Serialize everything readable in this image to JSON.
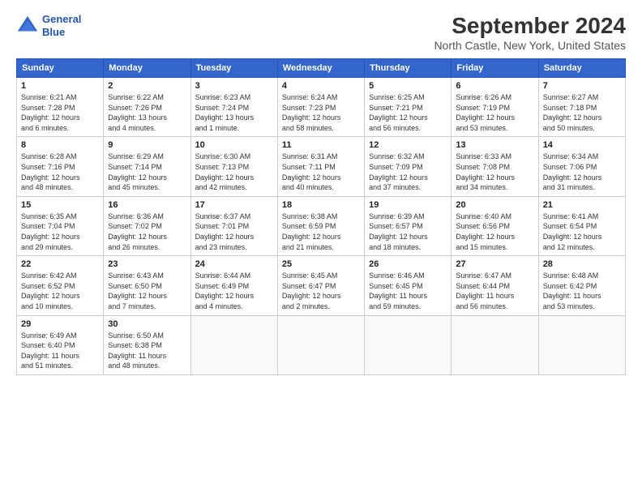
{
  "header": {
    "title": "September 2024",
    "subtitle": "North Castle, New York, United States",
    "logo_line1": "General",
    "logo_line2": "Blue"
  },
  "columns": [
    "Sunday",
    "Monday",
    "Tuesday",
    "Wednesday",
    "Thursday",
    "Friday",
    "Saturday"
  ],
  "weeks": [
    [
      {
        "day": "1",
        "info": "Sunrise: 6:21 AM\nSunset: 7:28 PM\nDaylight: 12 hours\nand 6 minutes."
      },
      {
        "day": "2",
        "info": "Sunrise: 6:22 AM\nSunset: 7:26 PM\nDaylight: 13 hours\nand 4 minutes."
      },
      {
        "day": "3",
        "info": "Sunrise: 6:23 AM\nSunset: 7:24 PM\nDaylight: 13 hours\nand 1 minute."
      },
      {
        "day": "4",
        "info": "Sunrise: 6:24 AM\nSunset: 7:23 PM\nDaylight: 12 hours\nand 58 minutes."
      },
      {
        "day": "5",
        "info": "Sunrise: 6:25 AM\nSunset: 7:21 PM\nDaylight: 12 hours\nand 56 minutes."
      },
      {
        "day": "6",
        "info": "Sunrise: 6:26 AM\nSunset: 7:19 PM\nDaylight: 12 hours\nand 53 minutes."
      },
      {
        "day": "7",
        "info": "Sunrise: 6:27 AM\nSunset: 7:18 PM\nDaylight: 12 hours\nand 50 minutes."
      }
    ],
    [
      {
        "day": "8",
        "info": "Sunrise: 6:28 AM\nSunset: 7:16 PM\nDaylight: 12 hours\nand 48 minutes."
      },
      {
        "day": "9",
        "info": "Sunrise: 6:29 AM\nSunset: 7:14 PM\nDaylight: 12 hours\nand 45 minutes."
      },
      {
        "day": "10",
        "info": "Sunrise: 6:30 AM\nSunset: 7:13 PM\nDaylight: 12 hours\nand 42 minutes."
      },
      {
        "day": "11",
        "info": "Sunrise: 6:31 AM\nSunset: 7:11 PM\nDaylight: 12 hours\nand 40 minutes."
      },
      {
        "day": "12",
        "info": "Sunrise: 6:32 AM\nSunset: 7:09 PM\nDaylight: 12 hours\nand 37 minutes."
      },
      {
        "day": "13",
        "info": "Sunrise: 6:33 AM\nSunset: 7:08 PM\nDaylight: 12 hours\nand 34 minutes."
      },
      {
        "day": "14",
        "info": "Sunrise: 6:34 AM\nSunset: 7:06 PM\nDaylight: 12 hours\nand 31 minutes."
      }
    ],
    [
      {
        "day": "15",
        "info": "Sunrise: 6:35 AM\nSunset: 7:04 PM\nDaylight: 12 hours\nand 29 minutes."
      },
      {
        "day": "16",
        "info": "Sunrise: 6:36 AM\nSunset: 7:02 PM\nDaylight: 12 hours\nand 26 minutes."
      },
      {
        "day": "17",
        "info": "Sunrise: 6:37 AM\nSunset: 7:01 PM\nDaylight: 12 hours\nand 23 minutes."
      },
      {
        "day": "18",
        "info": "Sunrise: 6:38 AM\nSunset: 6:59 PM\nDaylight: 12 hours\nand 21 minutes."
      },
      {
        "day": "19",
        "info": "Sunrise: 6:39 AM\nSunset: 6:57 PM\nDaylight: 12 hours\nand 18 minutes."
      },
      {
        "day": "20",
        "info": "Sunrise: 6:40 AM\nSunset: 6:56 PM\nDaylight: 12 hours\nand 15 minutes."
      },
      {
        "day": "21",
        "info": "Sunrise: 6:41 AM\nSunset: 6:54 PM\nDaylight: 12 hours\nand 12 minutes."
      }
    ],
    [
      {
        "day": "22",
        "info": "Sunrise: 6:42 AM\nSunset: 6:52 PM\nDaylight: 12 hours\nand 10 minutes."
      },
      {
        "day": "23",
        "info": "Sunrise: 6:43 AM\nSunset: 6:50 PM\nDaylight: 12 hours\nand 7 minutes."
      },
      {
        "day": "24",
        "info": "Sunrise: 6:44 AM\nSunset: 6:49 PM\nDaylight: 12 hours\nand 4 minutes."
      },
      {
        "day": "25",
        "info": "Sunrise: 6:45 AM\nSunset: 6:47 PM\nDaylight: 12 hours\nand 2 minutes."
      },
      {
        "day": "26",
        "info": "Sunrise: 6:46 AM\nSunset: 6:45 PM\nDaylight: 11 hours\nand 59 minutes."
      },
      {
        "day": "27",
        "info": "Sunrise: 6:47 AM\nSunset: 6:44 PM\nDaylight: 11 hours\nand 56 minutes."
      },
      {
        "day": "28",
        "info": "Sunrise: 6:48 AM\nSunset: 6:42 PM\nDaylight: 11 hours\nand 53 minutes."
      }
    ],
    [
      {
        "day": "29",
        "info": "Sunrise: 6:49 AM\nSunset: 6:40 PM\nDaylight: 11 hours\nand 51 minutes."
      },
      {
        "day": "30",
        "info": "Sunrise: 6:50 AM\nSunset: 6:38 PM\nDaylight: 11 hours\nand 48 minutes."
      },
      {
        "day": "",
        "info": ""
      },
      {
        "day": "",
        "info": ""
      },
      {
        "day": "",
        "info": ""
      },
      {
        "day": "",
        "info": ""
      },
      {
        "day": "",
        "info": ""
      }
    ]
  ]
}
